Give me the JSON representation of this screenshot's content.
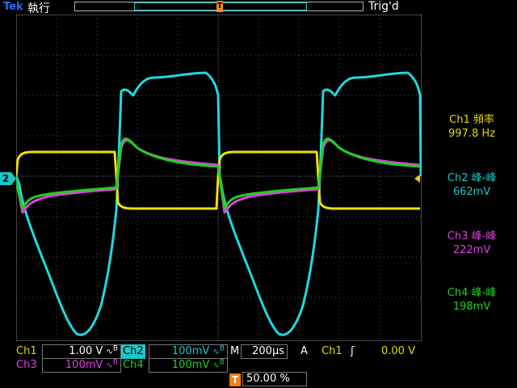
{
  "header": {
    "brand": "Tek",
    "run_state": "執行",
    "trigger_state": "Trig'd",
    "record_marker": "T"
  },
  "trigger_position_marker": "T",
  "channel2_marker": "2",
  "measurements": [
    {
      "label": "Ch1 頻率",
      "value": "997.8 Hz",
      "color": "#e8d800"
    },
    {
      "label": "Ch2 峰-峰",
      "value": "662mV",
      "color": "#18c8c8"
    },
    {
      "label": "Ch3 峰-峰",
      "value": "222mV",
      "color": "#e040e0"
    },
    {
      "label": "Ch4 峰-峰",
      "value": "198mV",
      "color": "#20d020"
    }
  ],
  "channels": [
    {
      "name": "Ch1",
      "scale": "1.00 V",
      "bw": "B",
      "color": "#e8d800"
    },
    {
      "name": "Ch2",
      "scale": "100mV",
      "bw": "B",
      "color": "#18c8c8"
    },
    {
      "name": "Ch3",
      "scale": "100mV",
      "bw": "B",
      "color": "#e040e0"
    },
    {
      "name": "Ch4",
      "scale": "100mV",
      "bw": "B",
      "color": "#20d020"
    }
  ],
  "timebase": {
    "label": "M",
    "value": "200µs"
  },
  "trigger": {
    "mode": "A",
    "source": "Ch1",
    "slope": "ʃ",
    "level": "0.00 V"
  },
  "trigger_position": {
    "marker": "T",
    "value": "50.00 %"
  }
}
